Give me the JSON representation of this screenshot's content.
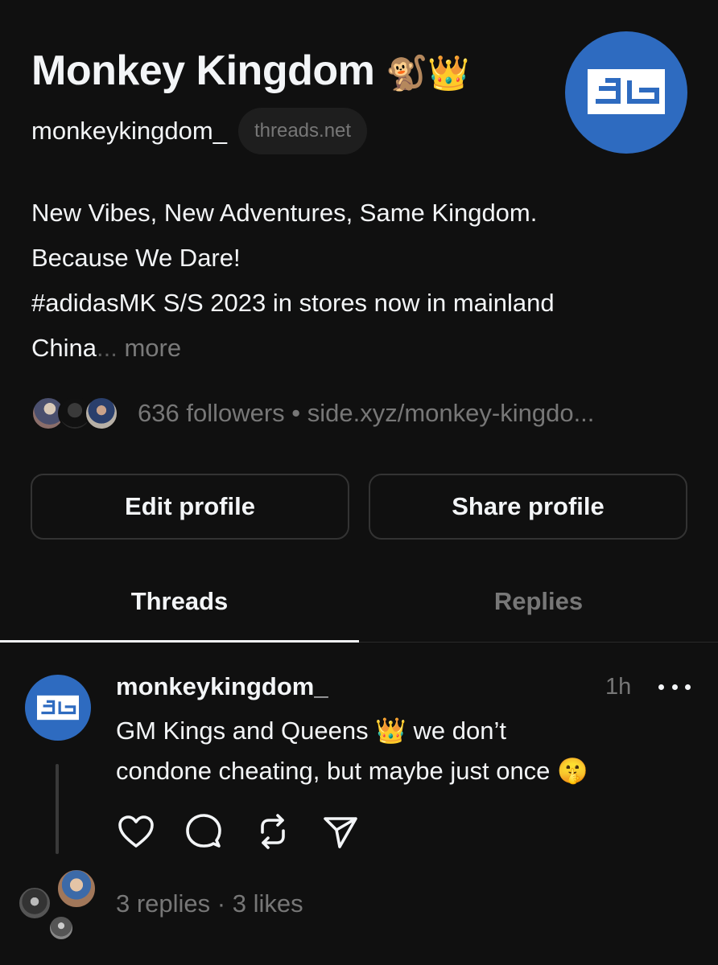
{
  "profile": {
    "name": "Monkey Kingdom",
    "name_emoji": "🐒👑",
    "handle": "monkeykingdom_",
    "domain": "threads.net",
    "bio_lines": [
      "New Vibes, New Adventures, Same Kingdom.",
      "Because We Dare!",
      "#adidasMK S/S 2023 in stores now in mainland",
      "China"
    ],
    "bio_ellipsis": "...",
    "bio_more": "more",
    "followers_text": "636 followers",
    "separator": " • ",
    "link": "side.xyz/monkey-kingdo..."
  },
  "buttons": {
    "edit": "Edit profile",
    "share": "Share profile"
  },
  "tabs": [
    {
      "label": "Threads",
      "active": true
    },
    {
      "label": "Replies",
      "active": false
    }
  ],
  "post": {
    "username": "monkeykingdom_",
    "time": "1h",
    "text_line1": "GM Kings and Queens",
    "text_emoji1": "👑",
    "text_line1b": "we don’t",
    "text_line2": "condone cheating, but maybe just once",
    "text_emoji2": "🤫",
    "stats": "3 replies · 3 likes"
  },
  "icons": {
    "like": "heart-icon",
    "reply": "comment-icon",
    "repost": "repost-icon",
    "share": "send-icon",
    "more": "more-horizontal-icon"
  },
  "colors": {
    "background": "#101010",
    "text": "#f3f5f7",
    "muted": "#777777",
    "avatar_blue": "#2e6bc0"
  }
}
